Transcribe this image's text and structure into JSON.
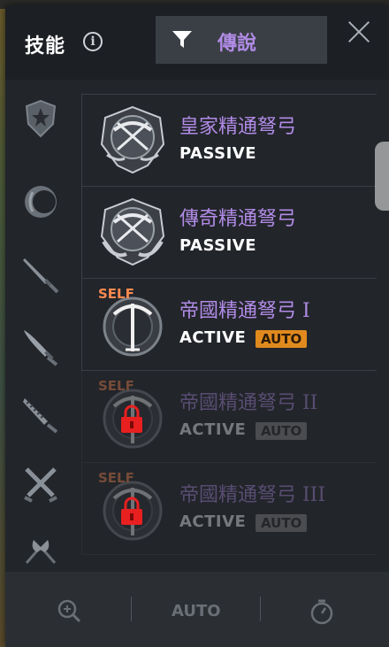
{
  "header": {
    "title": "技能",
    "filter_label": "傳說"
  },
  "sidebar": {
    "items": [
      "shield-icon",
      "ring-icon",
      "dagger-icon",
      "blade-icon",
      "serrated-blade-icon",
      "crossed-swords-icon",
      "axes-icon"
    ]
  },
  "skills": [
    {
      "name": "皇家精通弩弓",
      "type": "PASSIVE",
      "auto": "",
      "self": "",
      "locked": false
    },
    {
      "name": "傳奇精通弩弓",
      "type": "PASSIVE",
      "auto": "",
      "self": "",
      "locked": false
    },
    {
      "name": "帝國精通弩弓 I",
      "type": "ACTIVE",
      "auto": "AUTO",
      "self": "SELF",
      "locked": false
    },
    {
      "name": "帝國精通弩弓 II",
      "type": "ACTIVE",
      "auto": "AUTO",
      "self": "SELF",
      "locked": true
    },
    {
      "name": "帝國精通弩弓 III",
      "type": "ACTIVE",
      "auto": "AUTO",
      "self": "SELF",
      "locked": true
    }
  ],
  "footer": {
    "auto_label": "AUTO"
  },
  "colors": {
    "legend_purple": "#b18be6",
    "auto_orange": "#e08a1e",
    "self_orange": "#ff8a50",
    "lock_red": "#e82020"
  }
}
